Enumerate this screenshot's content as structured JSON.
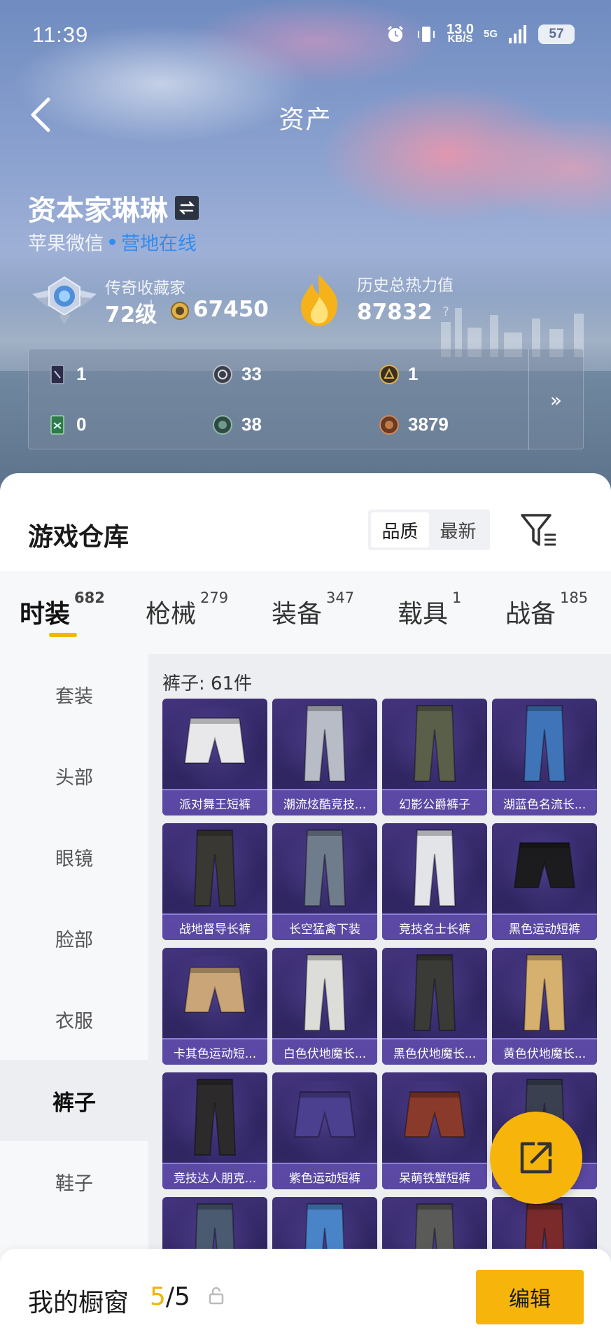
{
  "status_bar": {
    "time": "11:39",
    "net_speed": "13.0",
    "net_unit": "KB/S",
    "signal": "5G",
    "battery": "57"
  },
  "header": {
    "title": "资产"
  },
  "profile": {
    "name": "资本家琳琳",
    "platform": "苹果微信",
    "online_status": "营地在线",
    "rank_title": "传奇收藏家",
    "level": "72级",
    "coins": "67450",
    "heat_label": "历史总热力值",
    "heat_value": "87832",
    "help": "?"
  },
  "stats": [
    {
      "icon": "card-icon",
      "value": "1"
    },
    {
      "icon": "silver-coin-icon",
      "value": "33"
    },
    {
      "icon": "gold-badge-icon",
      "value": "1"
    },
    {
      "icon": "green-card-icon",
      "value": "0"
    },
    {
      "icon": "green-coin-icon",
      "value": "38"
    },
    {
      "icon": "bronze-coin-icon",
      "value": "3879"
    }
  ],
  "stats_more": "»",
  "warehouse": {
    "title": "游戏仓库",
    "sort_options": [
      "品质",
      "最新"
    ],
    "sort_selected": "品质"
  },
  "category_tabs": [
    {
      "label": "时装",
      "count": "682",
      "active": true
    },
    {
      "label": "枪械",
      "count": "279"
    },
    {
      "label": "装备",
      "count": "347"
    },
    {
      "label": "载具",
      "count": "1"
    },
    {
      "label": "战备",
      "count": "185"
    }
  ],
  "side_nav": [
    "套装",
    "头部",
    "眼镜",
    "脸部",
    "衣服",
    "裤子",
    "鞋子"
  ],
  "side_nav_active": "裤子",
  "grid": {
    "count_text": "裤子: 61件",
    "items": [
      {
        "name": "派对舞王短裤",
        "color": "#e8e8ea",
        "type": "shorts"
      },
      {
        "name": "潮流炫酷竞技...",
        "color": "#b8bcc6",
        "type": "pants"
      },
      {
        "name": "幻影公爵裤子",
        "color": "#5a5f4a",
        "type": "pants"
      },
      {
        "name": "湖蓝色名流长...",
        "color": "#3f74b8",
        "type": "pants"
      },
      {
        "name": "战地督导长裤",
        "color": "#3a3832",
        "type": "pants"
      },
      {
        "name": "长空猛禽下装",
        "color": "#6f7c8c",
        "type": "pants"
      },
      {
        "name": "竞技名士长裤",
        "color": "#e3e4e8",
        "type": "pants"
      },
      {
        "name": "黑色运动短裤",
        "color": "#1c1c1e",
        "type": "shorts"
      },
      {
        "name": "卡其色运动短...",
        "color": "#c9a577",
        "type": "shorts"
      },
      {
        "name": "白色伏地魔长...",
        "color": "#dcdcd8",
        "type": "pants"
      },
      {
        "name": "黑色伏地魔长...",
        "color": "#3a3a36",
        "type": "pants"
      },
      {
        "name": "黄色伏地魔长...",
        "color": "#d6b06e",
        "type": "pants"
      },
      {
        "name": "竞技达人朋克...",
        "color": "#2c2a2a",
        "type": "pants"
      },
      {
        "name": "紫色运动短裤",
        "color": "#4b3f8f",
        "type": "shorts"
      },
      {
        "name": "呆萌铁蟹短裤",
        "color": "#8a3a2a",
        "type": "shorts"
      },
      {
        "name": "...裤",
        "color": "#3a4050",
        "type": "pants"
      },
      {
        "name": "",
        "color": "#4a5a70",
        "type": "pants"
      },
      {
        "name": "",
        "color": "#4a84c8",
        "type": "pants"
      },
      {
        "name": "",
        "color": "#5a5a58",
        "type": "pants"
      },
      {
        "name": "",
        "color": "#7a2a2a",
        "type": "pants"
      }
    ]
  },
  "showcase": {
    "label": "我的橱窗",
    "current": "5",
    "total": "/5",
    "edit_label": "编辑"
  },
  "colors": {
    "accent": "#f7b50c",
    "online": "#2f8cf2",
    "card_bg": "#2f2560",
    "card_label": "#5b49a6"
  }
}
